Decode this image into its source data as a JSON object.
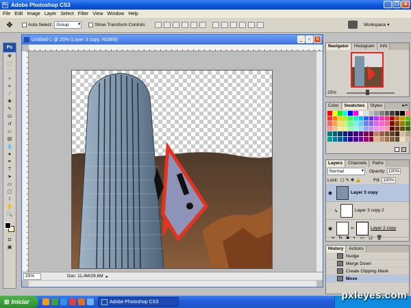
{
  "window": {
    "title": "Adobe Photoshop CS3",
    "icon_label": "Ps"
  },
  "menu": [
    "File",
    "Edit",
    "Image",
    "Layer",
    "Select",
    "Filter",
    "View",
    "Window",
    "Help"
  ],
  "options": {
    "auto_select_label": "Auto-Select:",
    "auto_select_value": "Group",
    "show_transform_label": "Show Transform Controls",
    "workspace_label": "Workspace ▾"
  },
  "toolbox": {
    "logo": "Ps"
  },
  "document": {
    "title": "Untitled-1 @ 25% (Layer 3 copy, RGB/8)",
    "zoom": "25%",
    "doc_size": "Doc: 11,4M/29,6M"
  },
  "panels": {
    "navigator": {
      "tabs": [
        "Navigator",
        "Histogram",
        "Info"
      ],
      "zoom": "25%"
    },
    "color": {
      "tabs": [
        "Color",
        "Swatches",
        "Styles"
      ]
    },
    "layers": {
      "tabs": [
        "Layers",
        "Channels",
        "Paths"
      ],
      "blend_mode": "Normal",
      "opacity_label": "Opacity:",
      "opacity_value": "100%",
      "lock_label": "Lock:",
      "fill_label": "Fill:",
      "fill_value": "100%",
      "items": [
        {
          "name": "Layer 3 copy",
          "selected": true
        },
        {
          "name": "Layer 3 copy 2",
          "selected": false
        },
        {
          "name": "Layer 2 copy",
          "selected": false
        }
      ]
    },
    "history": {
      "tabs": [
        "History",
        "Actions"
      ],
      "items": [
        {
          "name": "Nudge",
          "selected": false
        },
        {
          "name": "Merge Down",
          "selected": false
        },
        {
          "name": "Create Clipping Mask",
          "selected": false
        },
        {
          "name": "Move",
          "selected": true
        }
      ]
    }
  },
  "taskbar": {
    "start_label": "Iniciar",
    "task_label": "Adobe Photoshop CS3"
  },
  "watermark": "pxleyes.com",
  "swatch_colors": [
    "#ff0000",
    "#ffff00",
    "#00ff00",
    "#00ffff",
    "#0000ff",
    "#ff00ff",
    "#ffffff",
    "#e0e0e0",
    "#c0c0c0",
    "#a0a0a0",
    "#808080",
    "#606060",
    "#404040",
    "#202020",
    "#000000",
    "#ff8080",
    "#ffc080",
    "#ff3030",
    "#ff8000",
    "#ffd000",
    "#a0ff00",
    "#30ff60",
    "#00ffc0",
    "#00c0ff",
    "#3060ff",
    "#6030ff",
    "#c030ff",
    "#ff30c0",
    "#ff3080",
    "#c00000",
    "#c06000",
    "#c0a000",
    "#60c000",
    "#00c060",
    "#ff6060",
    "#ffa040",
    "#ffe060",
    "#c0ff60",
    "#60ff90",
    "#60ffe0",
    "#60d0ff",
    "#6080ff",
    "#9060ff",
    "#e060ff",
    "#ff60d0",
    "#ff6090",
    "#900000",
    "#904000",
    "#908000",
    "#409000",
    "#009040",
    "#ff9090",
    "#ffc090",
    "#fff090",
    "#e0ff90",
    "#90ffb0",
    "#90fff0",
    "#90e0ff",
    "#90a8ff",
    "#b890ff",
    "#f090ff",
    "#ff90e0",
    "#ff90b0",
    "#600000",
    "#603000",
    "#605000",
    "#306000",
    "#006030",
    "#008080",
    "#006080",
    "#004080",
    "#002080",
    "#200080",
    "#400080",
    "#600080",
    "#800060",
    "#800030",
    "#c08060",
    "#a06040",
    "#805030",
    "#604020",
    "#402010",
    "#d0c0a0",
    "#b0a080",
    "#908060",
    "#00a0a0",
    "#0080a0",
    "#0060a0",
    "#0040a0",
    "#3000a0",
    "#5000a0",
    "#7000a0",
    "#a00080",
    "#a00040",
    "#e0b090",
    "#c09070",
    "#a07050",
    "#806040",
    "#605030",
    "#f0e0c0",
    "#d0c0a0",
    "#b0a080"
  ]
}
